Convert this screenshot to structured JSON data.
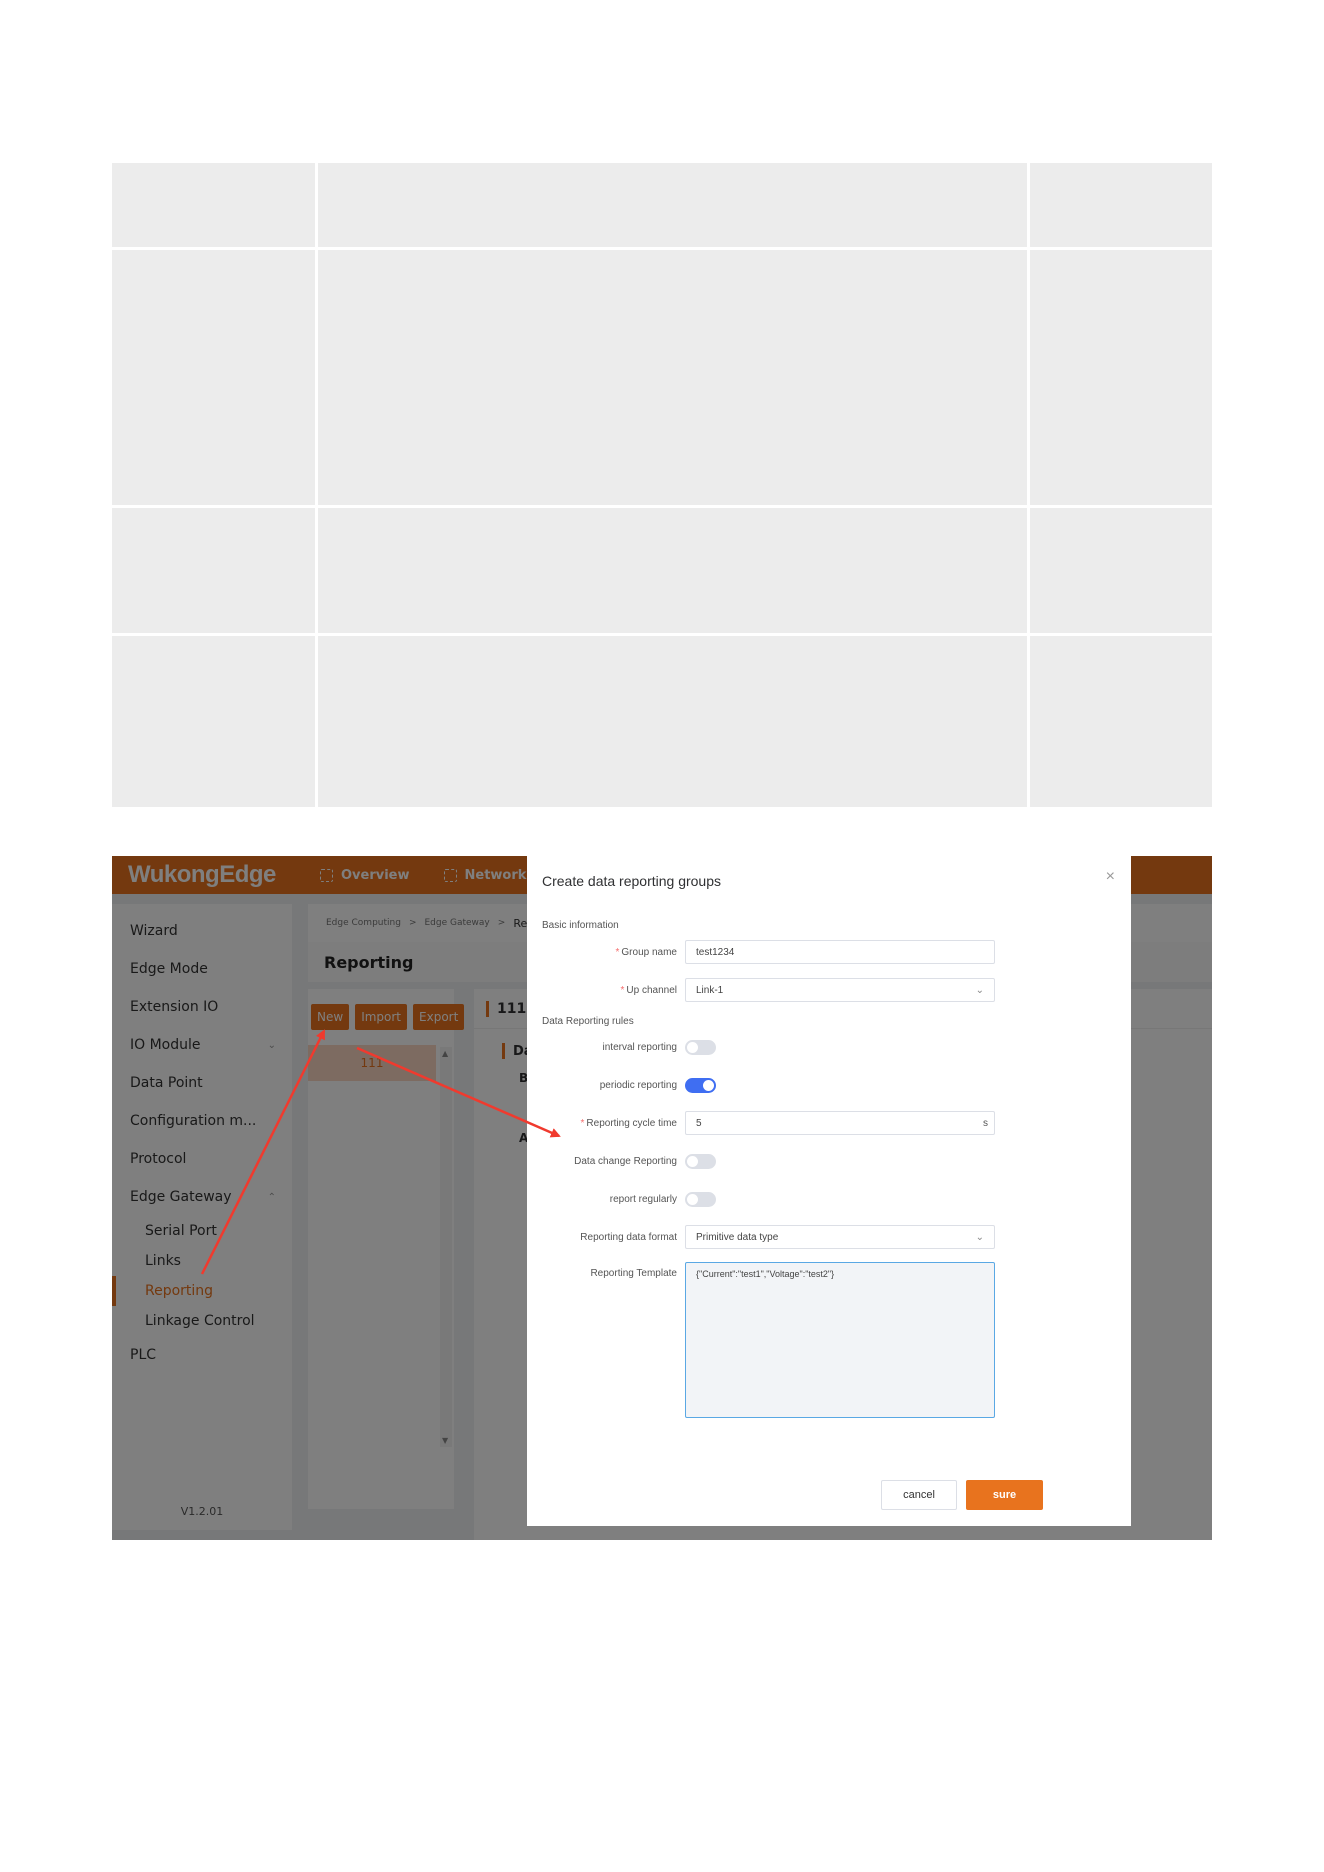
{
  "app": {
    "logo": "WukongEdge",
    "top_nav": [
      {
        "label": "Overview",
        "icon": "focus-icon"
      },
      {
        "label": "Network",
        "icon": "focus-icon"
      }
    ],
    "version": "V1.2.01"
  },
  "sidebar": {
    "items": [
      {
        "label": "Wizard"
      },
      {
        "label": "Edge Mode"
      },
      {
        "label": "Extension IO"
      },
      {
        "label": "IO Module"
      },
      {
        "label": "Data Point"
      },
      {
        "label": "Configuration m..."
      },
      {
        "label": "Protocol"
      },
      {
        "label": "Edge Gateway"
      }
    ],
    "sub_items": [
      {
        "label": "Serial Port"
      },
      {
        "label": "Links"
      },
      {
        "label": "Reporting"
      },
      {
        "label": "Linkage Control"
      }
    ],
    "tail_item": "PLC"
  },
  "breadcrumb": [
    "Edge Computing",
    ">",
    "Edge Gateway",
    ">",
    "Repor"
  ],
  "page": {
    "title": "Reporting",
    "toolbar": {
      "new": "New",
      "import": "Import",
      "export": "Export"
    },
    "groups": [
      "111"
    ],
    "detail_title": "111",
    "detail_sub": "Da",
    "fragments": [
      "B",
      "A"
    ]
  },
  "dialog": {
    "title": "Create data reporting groups",
    "close": "×",
    "basic_info": "Basic information",
    "rules": "Data Reporting rules",
    "group_name_label": "Group name",
    "group_name_value": "test1234",
    "up_channel_label": "Up channel",
    "up_channel_value": "Link-1",
    "interval_label": "interval reporting",
    "interval_on": false,
    "periodic_label": "periodic reporting",
    "periodic_on": true,
    "cycle_label": "Reporting cycle time",
    "cycle_value": "5",
    "cycle_unit": "s",
    "change_label": "Data change Reporting",
    "change_on": false,
    "regular_label": "report regularly",
    "regular_on": false,
    "format_label": "Reporting data format",
    "format_value": "Primitive data type",
    "template_label": "Reporting Template",
    "template_value": "{\"Current\":\"test1\",\"Voltage\":\"test2\"}",
    "cancel": "cancel",
    "sure": "sure"
  },
  "colors": {
    "brand": "#e8731e",
    "switch_on": "#3f6ef2",
    "annotation_arrow": "#f03a2e"
  }
}
